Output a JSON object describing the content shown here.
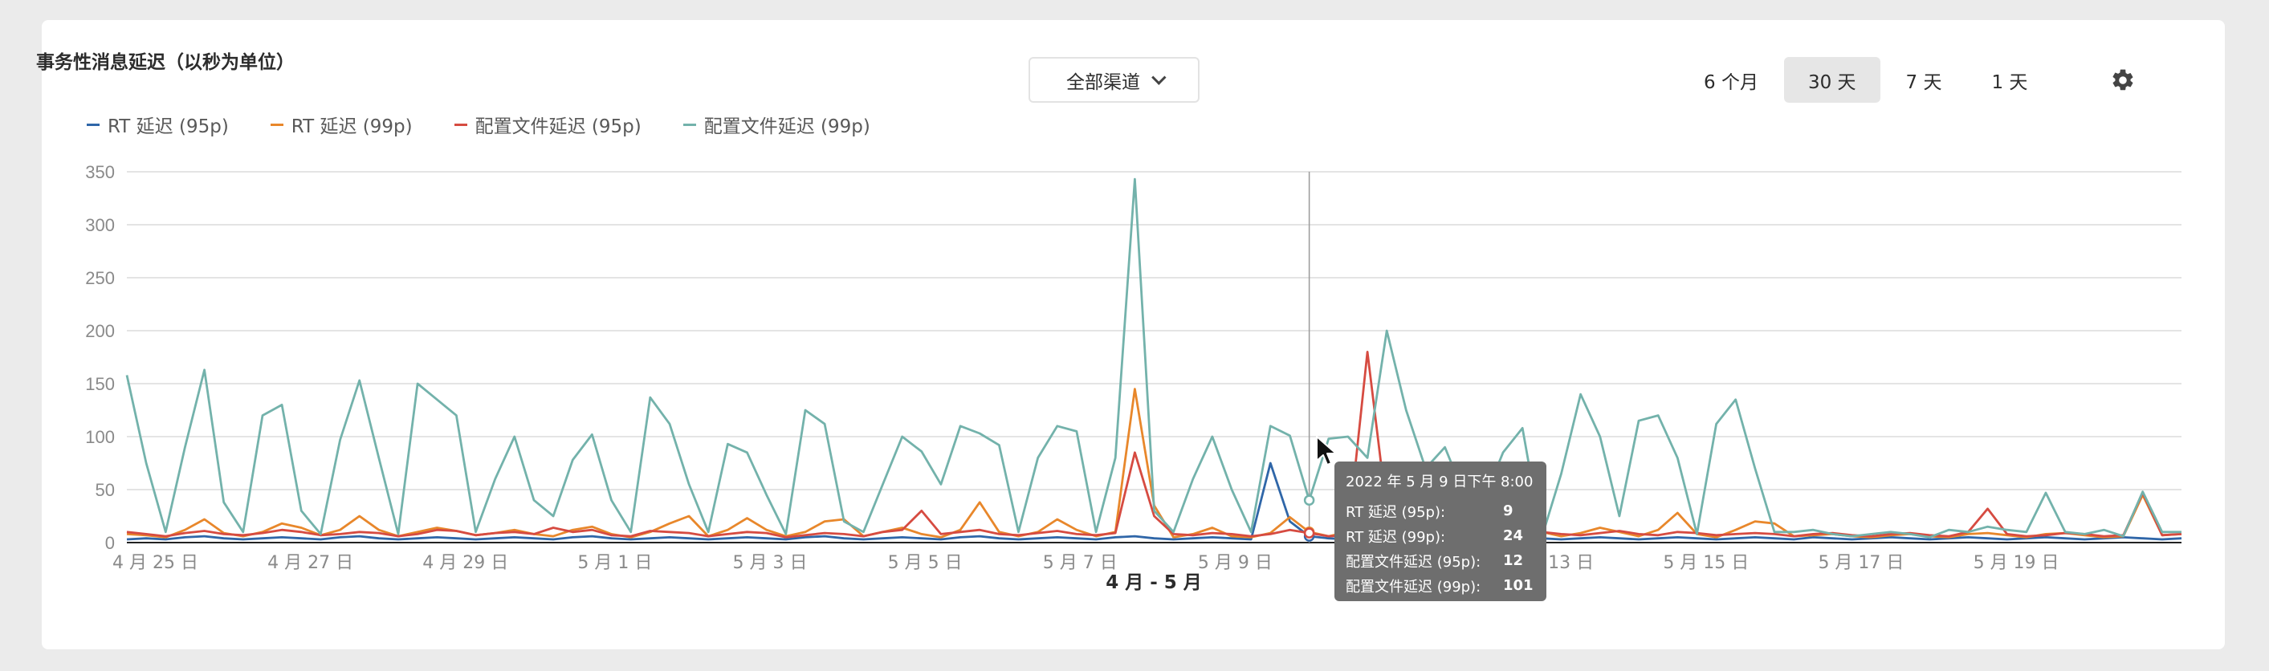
{
  "card": {
    "title": "事务性消息延迟（以秒为单位）"
  },
  "filter": {
    "channel_label": "全部渠道"
  },
  "range": {
    "options": [
      "6 个月",
      "30 天",
      "7 天",
      "1 天"
    ],
    "active": "30 天"
  },
  "icons": {
    "settings": "gear-icon",
    "dropdown": "chevron-down-icon",
    "pointer": "mouse-pointer-icon"
  },
  "legend": [
    {
      "label": "RT 延迟 (95p)",
      "color": "#2f66a8"
    },
    {
      "label": "RT 延迟 (99p)",
      "color": "#e8872b"
    },
    {
      "label": "配置文件延迟 (95p)",
      "color": "#d64b41"
    },
    {
      "label": "配置文件延迟 (99p)",
      "color": "#73b2ab"
    }
  ],
  "tooltip": {
    "title": "2022 年 5 月 9 日下午 8:00",
    "rows": [
      {
        "label": "RT 延迟 (95p):",
        "value": "9"
      },
      {
        "label": "RT 延迟 (99p):",
        "value": "24"
      },
      {
        "label": "配置文件延迟 (95p):",
        "value": "12"
      },
      {
        "label": "配置文件延迟 (99p):",
        "value": "101"
      }
    ]
  },
  "chart_data": {
    "type": "line",
    "xlabel": "4 月 - 5 月",
    "ylabel": "",
    "ylim": [
      0,
      350
    ],
    "yticks": [
      0,
      50,
      100,
      150,
      200,
      250,
      300,
      350
    ],
    "xlim": [
      0,
      106
    ],
    "x_tick_labels": [
      {
        "x": 0,
        "label": "4 月 25 日"
      },
      {
        "x": 8,
        "label": "4 月 27 日"
      },
      {
        "x": 16,
        "label": "4 月 29 日"
      },
      {
        "x": 24,
        "label": "5 月 1 日"
      },
      {
        "x": 32,
        "label": "5 月 3 日"
      },
      {
        "x": 40,
        "label": "5 月 5 日"
      },
      {
        "x": 48,
        "label": "5 月 7 日"
      },
      {
        "x": 56,
        "label": "5 月 9 日"
      },
      {
        "x": 64,
        "label": "5 月 11 日"
      },
      {
        "x": 72,
        "label": "5 月 13 日"
      },
      {
        "x": 80,
        "label": "5 月 15 日"
      },
      {
        "x": 88,
        "label": "5 月 17 日"
      },
      {
        "x": 96,
        "label": "5 月 19 日"
      }
    ],
    "grid": true,
    "hover_index": 61,
    "series": [
      {
        "name": "RT 延迟 (95p)",
        "color": "#2f66a8",
        "values": [
          3,
          4,
          3,
          5,
          6,
          4,
          3,
          4,
          5,
          4,
          3,
          5,
          6,
          4,
          3,
          4,
          5,
          4,
          3,
          4,
          5,
          4,
          3,
          5,
          6,
          4,
          3,
          4,
          5,
          4,
          3,
          4,
          5,
          4,
          3,
          5,
          6,
          4,
          3,
          4,
          5,
          4,
          3,
          5,
          6,
          4,
          3,
          4,
          5,
          4,
          3,
          5,
          6,
          4,
          3,
          4,
          5,
          4,
          3,
          75,
          20,
          6,
          4,
          3,
          4,
          5,
          4,
          3,
          9,
          5,
          4,
          3,
          5,
          4,
          3,
          4,
          5,
          4,
          3,
          4,
          5,
          4,
          3,
          4,
          5,
          4,
          3,
          5,
          4,
          3,
          4,
          5,
          4,
          3,
          4,
          5,
          4,
          3,
          4,
          5,
          4,
          3,
          4,
          5,
          4,
          3,
          4
        ]
      },
      {
        "name": "RT 延迟 (99p)",
        "color": "#e8872b",
        "values": [
          8,
          7,
          5,
          12,
          22,
          9,
          6,
          10,
          18,
          14,
          7,
          12,
          25,
          12,
          6,
          10,
          14,
          11,
          7,
          9,
          12,
          8,
          6,
          12,
          15,
          8,
          5,
          10,
          18,
          25,
          6,
          12,
          23,
          12,
          6,
          10,
          20,
          22,
          6,
          10,
          14,
          8,
          5,
          12,
          38,
          10,
          6,
          10,
          22,
          12,
          6,
          10,
          145,
          35,
          5,
          8,
          14,
          6,
          5,
          9,
          24,
          10,
          6,
          10,
          14,
          8,
          5,
          12,
          18,
          10,
          5,
          10,
          18,
          10,
          6,
          9,
          14,
          10,
          6,
          12,
          28,
          8,
          5,
          12,
          20,
          18,
          6,
          7,
          8,
          6,
          5,
          7,
          8,
          6,
          5,
          8,
          9,
          7,
          5,
          8,
          9,
          7,
          5,
          6,
          45,
          7,
          8
        ]
      },
      {
        "name": "配置文件延迟 (95p)",
        "color": "#d64b41",
        "values": [
          10,
          8,
          6,
          9,
          11,
          8,
          7,
          9,
          12,
          10,
          7,
          8,
          10,
          9,
          6,
          8,
          12,
          11,
          7,
          9,
          10,
          8,
          14,
          10,
          12,
          7,
          6,
          11,
          10,
          9,
          6,
          8,
          10,
          9,
          5,
          7,
          9,
          8,
          6,
          10,
          12,
          30,
          8,
          10,
          12,
          8,
          7,
          9,
          11,
          8,
          7,
          9,
          85,
          25,
          8,
          7,
          9,
          8,
          6,
          8,
          12,
          9,
          6,
          7,
          180,
          30,
          8,
          7,
          9,
          10,
          8,
          6,
          9,
          10,
          8,
          7,
          9,
          11,
          8,
          7,
          10,
          9,
          7,
          8,
          9,
          8,
          6,
          8,
          9,
          7,
          6,
          8,
          9,
          7,
          6,
          10,
          32,
          8,
          6,
          7,
          9,
          8,
          6,
          7,
          47,
          7,
          8
        ]
      },
      {
        "name": "配置文件延迟 (99p)",
        "color": "#73b2ab",
        "values": [
          158,
          75,
          10,
          90,
          163,
          38,
          10,
          120,
          130,
          30,
          8,
          97,
          153,
          80,
          8,
          150,
          135,
          120,
          10,
          60,
          100,
          40,
          25,
          78,
          102,
          40,
          10,
          137,
          112,
          55,
          10,
          93,
          85,
          45,
          8,
          125,
          112,
          20,
          10,
          55,
          100,
          86,
          55,
          110,
          103,
          92,
          10,
          80,
          110,
          105,
          10,
          80,
          343,
          30,
          10,
          60,
          100,
          50,
          10,
          110,
          101,
          40,
          98,
          100,
          80,
          200,
          125,
          70,
          90,
          45,
          40,
          85,
          108,
          5,
          65,
          140,
          100,
          25,
          115,
          120,
          80,
          8,
          112,
          135,
          70,
          10,
          10,
          12,
          8,
          6,
          8,
          10,
          8,
          5,
          12,
          10,
          15,
          12,
          10,
          47,
          10,
          8,
          12,
          6,
          48,
          10,
          10
        ]
      }
    ]
  }
}
